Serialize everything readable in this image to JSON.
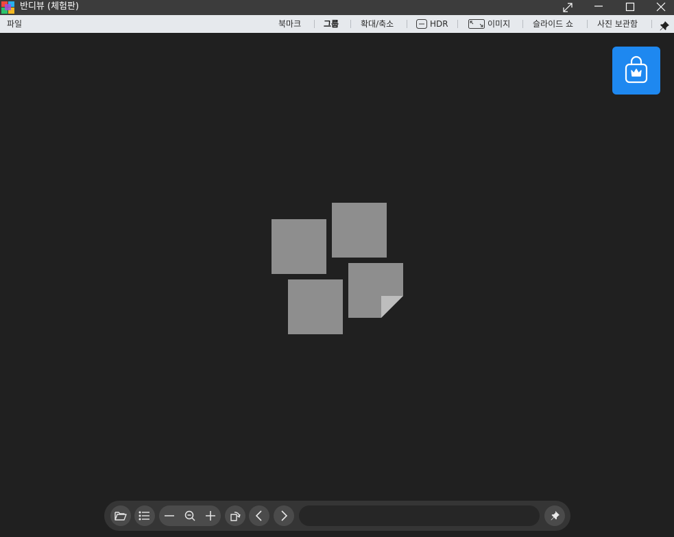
{
  "window": {
    "title": "반디뷰 (체험판)"
  },
  "menubar": {
    "file": "파일",
    "bookmark": "북마크",
    "group": "그룹",
    "zoom": "확대/축소",
    "hdr": "HDR",
    "image": "이미지",
    "slideshow": "슬라이드 쇼",
    "photo_storage": "사진 보관함"
  },
  "toolbar": {
    "filename_value": ""
  },
  "icons": {
    "logo": "bandiview-logo-icon",
    "fullscreen": "expand-arrows-icon",
    "minimize": "minimize-icon",
    "maximize": "maximize-icon",
    "close": "close-icon",
    "pin": "pin-icon",
    "upgrade": "shopping-bag-crown-icon",
    "open_folder": "folder-open-icon",
    "list": "list-icon",
    "zoom_out": "minus-icon",
    "zoom_reset": "magnifier-minus-icon",
    "zoom_in": "plus-icon",
    "rotate": "rotate-icon",
    "prev": "chevron-left-icon",
    "next": "chevron-right-icon"
  },
  "colors": {
    "title_bar": "#3c3c3c",
    "menu_bar": "#e6e9ed",
    "canvas": "#202020",
    "accent": "#1e88f0",
    "toolbar": "#353535",
    "placeholder_tile": "#8e8e8e"
  }
}
